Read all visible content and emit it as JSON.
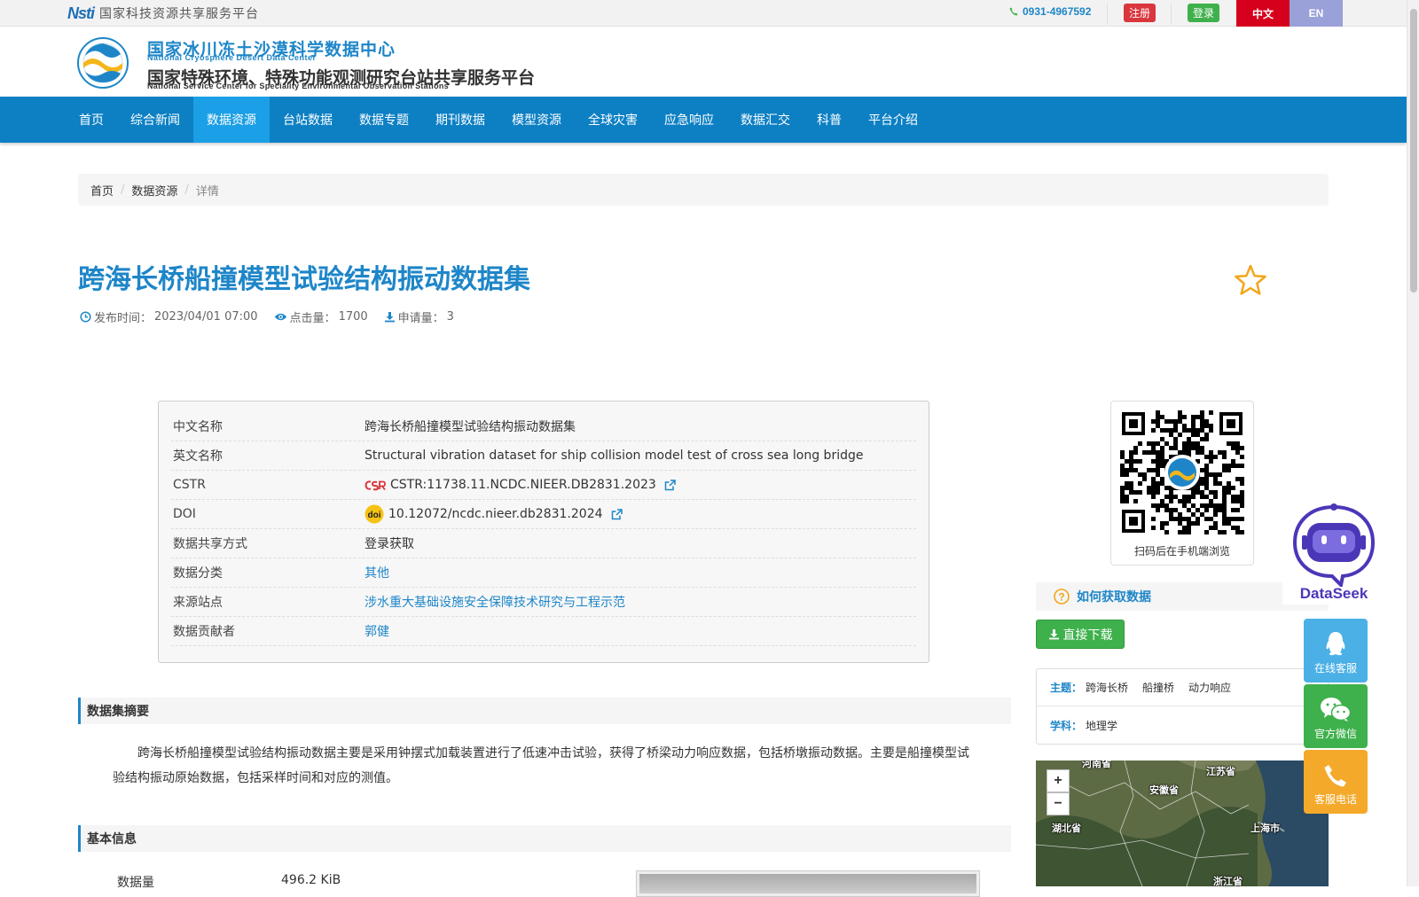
{
  "topbar": {
    "nsti_mark": "Nsti",
    "nsti_title": "国家科技资源共享服务平台",
    "phone": "0931-4967592",
    "register": "注册",
    "login": "登录",
    "lang_zh": "中文",
    "lang_en": "EN"
  },
  "header": {
    "center_cn": "国家冰川冻土沙漠科学数据中心",
    "center_en": "National Cryosphere Desert Data Center",
    "platform_cn": "国家特殊环境、特殊功能观测研究台站共享服务平台",
    "platform_en": "National Service Center for Speciality Environmental Observation Stations"
  },
  "nav": {
    "items": [
      "首页",
      "综合新闻",
      "数据资源",
      "台站数据",
      "数据专题",
      "期刊数据",
      "模型资源",
      "全球灾害",
      "应急响应",
      "数据汇交",
      "科普",
      "平台介绍"
    ],
    "active": "数据资源"
  },
  "breadcrumb": [
    "首页",
    "数据资源",
    "详情"
  ],
  "dataset": {
    "title": "跨海长桥船撞模型试验结构振动数据集",
    "publish_label": "发布时间：",
    "publish_time": "2023/04/01 07:00",
    "clicks_label": "点击量：",
    "clicks": "1700",
    "requests_label": "申请量：",
    "requests": "3"
  },
  "info_table": {
    "rows": [
      {
        "label": "中文名称",
        "value": "跨海长桥船撞模型试验结构振动数据集"
      },
      {
        "label": "英文名称",
        "value": "Structural vibration dataset for ship collision model test of cross sea long bridge"
      },
      {
        "label": "CSTR",
        "value": "CSTR:11738.11.NCDC.NIEER.DB2831.2023"
      },
      {
        "label": "DOI",
        "value": "10.12072/ncdc.nieer.db2831.2024"
      },
      {
        "label": "数据共享方式",
        "value": "登录获取"
      },
      {
        "label": "数据分类",
        "value": "其他"
      },
      {
        "label": "来源站点",
        "value": "涉水重大基础设施安全保障技术研究与工程示范"
      },
      {
        "label": "数据贡献者",
        "value": "郭健"
      }
    ]
  },
  "abstract": {
    "heading": "数据集摘要",
    "text": "跨海长桥船撞模型试验结构振动数据主要是采用钟摆式加载装置进行了低速冲击试验，获得了桥梁动力响应数据，包括桥墩振动数据。主要是船撞模型试验结构振动原始数据，包括采样时间和对应的测值。"
  },
  "basic_info": {
    "heading": "基本信息",
    "volume_label": "数据量",
    "volume": "496.2 KiB"
  },
  "sidebar": {
    "qr_caption": "扫码后在手机端浏览",
    "howto": "如何获取数据",
    "download": "直接下载",
    "topic_label": "主题：",
    "topics": [
      "跨海长桥",
      "船撞桥",
      "动力响应"
    ],
    "subject_label": "学科：",
    "subject": "地理学",
    "map": {
      "zoom_in": "+",
      "zoom_out": "−",
      "labels": [
        "河南省",
        "江苏省",
        "安徽省",
        "湖北省",
        "上海市",
        "浙江省"
      ]
    }
  },
  "floating": {
    "dataseek": "DataSeek",
    "online_service": "在线客服",
    "wechat": "官方微信",
    "phone_service": "客服电话"
  },
  "colors": {
    "brand_blue": "#0d80c4",
    "nav_active": "#1b9fe6",
    "title_blue": "#1e86c8",
    "register_red": "#d9363e",
    "login_green": "#3fb14c",
    "lang_zh_bg": "#d6001c",
    "lang_en_bg": "#9aa0d8"
  }
}
